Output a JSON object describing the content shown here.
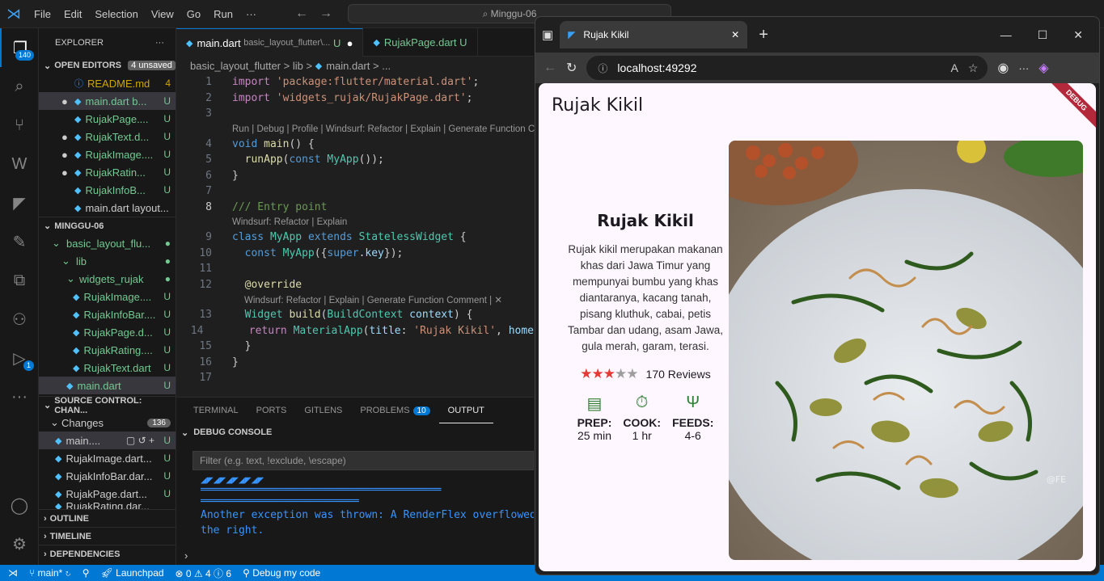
{
  "titlebar": {
    "menu": [
      "File",
      "Edit",
      "Selection",
      "View",
      "Go",
      "Run",
      "···"
    ],
    "search": "Minggu-06"
  },
  "activity": {
    "explorer_badge": "140",
    "debug_badge": "1"
  },
  "explorer": {
    "title": "EXPLORER",
    "open_editors": {
      "label": "OPEN EDITORS",
      "unsaved": "4 unsaved",
      "items": [
        {
          "name": "README.md",
          "status": "4",
          "dot": false
        },
        {
          "name": "main.dart b...",
          "status": "U",
          "dot": true
        },
        {
          "name": "RujakPage....",
          "status": "U",
          "dot": false
        },
        {
          "name": "RujakText.d...",
          "status": "U",
          "dot": true
        },
        {
          "name": "RujakImage....",
          "status": "U",
          "dot": true
        },
        {
          "name": "RujakRatin...",
          "status": "U",
          "dot": true
        },
        {
          "name": "RujakInfoB...",
          "status": "U",
          "dot": false
        },
        {
          "name": "main.dart layout...",
          "status": "",
          "dot": false
        }
      ]
    },
    "workspace": {
      "label": "MINGGU-06",
      "items": [
        {
          "name": "basic_layout_flu...",
          "indent": 1
        },
        {
          "name": "lib",
          "indent": 2
        },
        {
          "name": "widgets_rujak",
          "indent": 3
        },
        {
          "name": "RujakImage....",
          "indent": 4,
          "status": "U"
        },
        {
          "name": "RujakInfoBar....",
          "indent": 4,
          "status": "U"
        },
        {
          "name": "RujakPage.d...",
          "indent": 4,
          "status": "U"
        },
        {
          "name": "RujakRating....",
          "indent": 4,
          "status": "U"
        },
        {
          "name": "RujakText.dart",
          "indent": 4,
          "status": "U"
        },
        {
          "name": "main.dart",
          "indent": 3,
          "status": "U"
        }
      ]
    },
    "scm": {
      "label": "SOURCE CONTROL: CHAN...",
      "changes": "Changes",
      "count": "136",
      "items": [
        "main....",
        "RujakImage.dart...",
        "RujakInfoBar.dar...",
        "RujakPage.dart...",
        "RujakRating.dar..."
      ]
    },
    "outline": "OUTLINE",
    "timeline": "TIMELINE",
    "deps": "DEPENDENCIES"
  },
  "editor": {
    "tabs": [
      {
        "name": "main.dart",
        "path": "basic_layout_flutter\\...",
        "status": "U"
      },
      {
        "name": "RujakPage.dart",
        "status": "U"
      }
    ],
    "crumbs": [
      "basic_layout_flutter",
      ">",
      "lib",
      ">",
      "main.dart",
      ">",
      "..."
    ],
    "lens1": "Run | Debug | Profile | Windsurf: Refactor | Explain | Generate Function C",
    "lens2": "Windsurf: Refactor | Explain",
    "lens3": "Windsurf: Refactor | Explain | Generate Function Comment | ✕"
  },
  "panel": {
    "tabs": [
      "TERMINAL",
      "PORTS",
      "GITLENS",
      "PROBLEMS",
      "OUTPUT"
    ],
    "problems": "10",
    "debug_console": "DEBUG CONSOLE",
    "filter": "Filter (e.g. text, !exclude, \\escape)",
    "lines": [
      "◢◤◢◤◢◤◢◤◢◤",
      "══════════════════════════════════════",
      "═════════════════════════",
      "Another exception was thrown: A RenderFlex overflowed by",
      "the right."
    ]
  },
  "status": {
    "branch": "main*",
    "launch": "Launchpad",
    "problems": "⊗ 0  ⚠ 4  ⓘ 6",
    "debug": "Debug my code"
  },
  "browser": {
    "tab_title": "Rujak Kikil",
    "url": "localhost:49292"
  },
  "app": {
    "appbar_title": "Rujak Kikil",
    "debug": "DEBUG",
    "title": "Rujak Kikil",
    "description": "Rujak kikil merupakan makanan khas dari Jawa Timur yang mempunyai bumbu yang khas diantaranya, kacang tanah, pisang kluthuk, cabai, petis Tambar dan udang, asam Jawa, gula merah, garam, terasi.",
    "rating": 3,
    "reviews": "170 Reviews",
    "info": [
      {
        "label": "PREP:",
        "value": "25 min",
        "icon": "kitchen-icon"
      },
      {
        "label": "COOK:",
        "value": "1 hr",
        "icon": "timer-icon"
      },
      {
        "label": "FEEDS:",
        "value": "4-6",
        "icon": "restaurant-icon"
      }
    ],
    "watermark": "@FE"
  }
}
